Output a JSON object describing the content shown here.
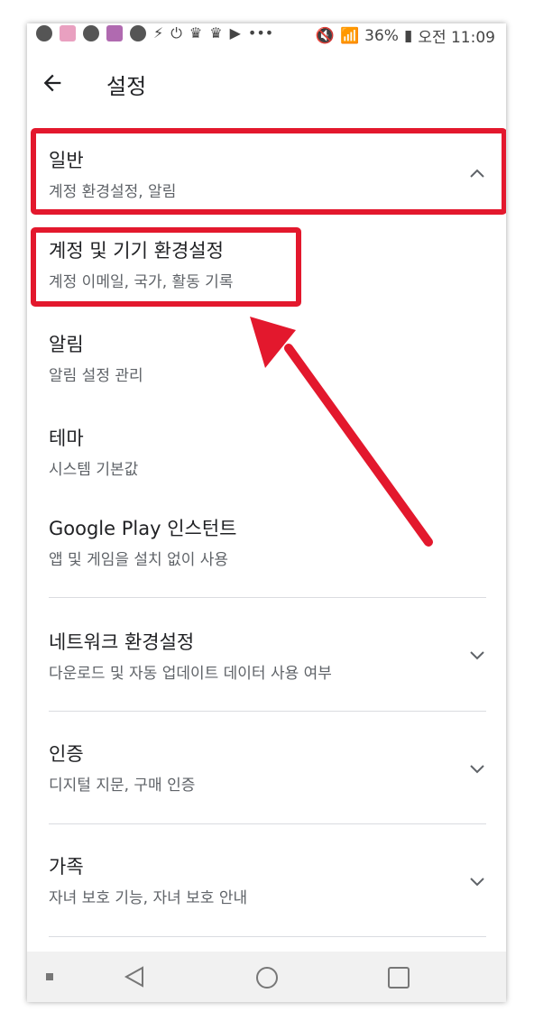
{
  "status_bar": {
    "battery": "36%",
    "time": "오전 11:09",
    "more": "•••"
  },
  "header": {
    "title": "설정"
  },
  "sections": {
    "general": {
      "title": "일반",
      "subtitle": "계정 환경설정, 알림"
    },
    "account": {
      "title": "계정 및 기기 환경설정",
      "subtitle": "계정 이메일, 국가, 활동 기록"
    },
    "notifications": {
      "title": "알림",
      "subtitle": "알림 설정 관리"
    },
    "theme": {
      "title": "테마",
      "subtitle": "시스템 기본값"
    },
    "instant": {
      "title": "Google Play 인스턴트",
      "subtitle": "앱 및 게임을 설치 없이 사용"
    },
    "network": {
      "title": "네트워크 환경설정",
      "subtitle": "다운로드 및 자동 업데이트 데이터 사용 여부"
    },
    "auth": {
      "title": "인증",
      "subtitle": "디지털 지문, 구매 인증"
    },
    "family": {
      "title": "가족",
      "subtitle": "자녀 보호 기능, 자녀 보호 안내"
    }
  },
  "colors": {
    "highlight": "#e3182d",
    "text_primary": "#202124",
    "text_secondary": "#5f6368",
    "divider": "#dadce0"
  }
}
